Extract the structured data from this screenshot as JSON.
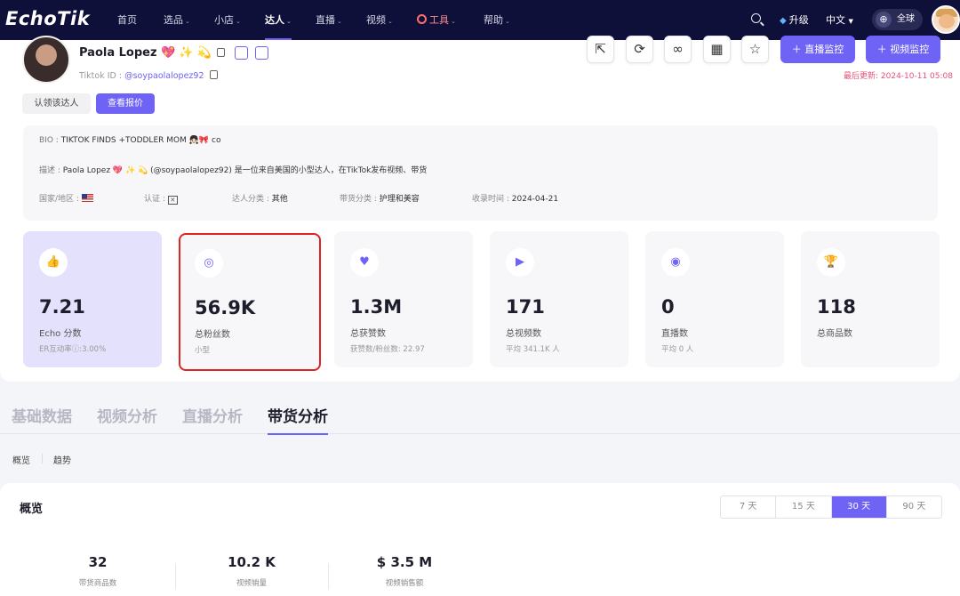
{
  "nav": {
    "logo": "EchoTik",
    "items": [
      {
        "label": "首页",
        "caret": ""
      },
      {
        "label": "选品",
        "caret": "⌄"
      },
      {
        "label": "小店",
        "caret": "⌄"
      },
      {
        "label": "达人",
        "caret": "⌄"
      },
      {
        "label": "直播",
        "caret": "⌄"
      },
      {
        "label": "视频",
        "caret": "⌄"
      },
      {
        "label": "工具",
        "caret": "⌄"
      },
      {
        "label": "帮助",
        "caret": "⌄"
      }
    ],
    "active_index": 3,
    "upgrade": "升级",
    "language": "中文",
    "region": "全球"
  },
  "profile": {
    "name": "Paola Lopez",
    "name_emoji": "💖 ✨ 💫",
    "handle_prefix": "Tiktok ID :",
    "handle": "@soypaolalopez92",
    "updated": "最后更新: 2024-10-11 05:08",
    "claim_button": "认领该达人",
    "quote_button": "查看报价",
    "live_monitor": "直播监控",
    "video_monitor": "视频监控",
    "bio_label": "BIO :",
    "bio": "TIKTOK FINDS +TODDLER MOM 👧🏻🎀 co",
    "desc_label": "描述 :",
    "desc": "Paola Lopez 💖 ✨ 💫 (@soypaolalopez92) 是一位来自美国的小型达人，在TikTok发布视频、带货",
    "country_label": "国家/地区 :",
    "verify_label": "认证 :",
    "category_label": "达人分类 :",
    "category": "其他",
    "goods_category_label": "带货分类 :",
    "goods_category": "护理和美容",
    "indexed_label": "收录时间 :",
    "indexed": "2024-04-21"
  },
  "stats": [
    {
      "icon": "thumbs-up-icon",
      "glyph": "👍",
      "value": "7.21",
      "label": "Echo 分数",
      "sub": "ER互动率ⓘ:3.00%"
    },
    {
      "icon": "target-icon",
      "glyph": "◎",
      "value": "56.9K",
      "label": "总粉丝数",
      "sub": "小型"
    },
    {
      "icon": "heart-icon",
      "glyph": "♥",
      "value": "1.3M",
      "label": "总获赞数",
      "sub": "获赞数/粉丝数: 22.97"
    },
    {
      "icon": "video-icon",
      "glyph": "▶",
      "value": "171",
      "label": "总视频数",
      "sub": "平均 341.1K 人"
    },
    {
      "icon": "live-icon",
      "glyph": "◉",
      "value": "0",
      "label": "直播数",
      "sub": "平均 0 人"
    },
    {
      "icon": "trophy-icon",
      "glyph": "🏆",
      "value": "118",
      "label": "总商品数",
      "sub": ""
    }
  ],
  "tabs": [
    "基础数据",
    "视频分析",
    "直播分析",
    "带货分析"
  ],
  "active_tab": 3,
  "subtabs": [
    "概览",
    "趋势"
  ],
  "overview": {
    "title": "概览",
    "ranges": [
      "7 天",
      "15 天",
      "30 天",
      "90 天"
    ],
    "active_range": 2,
    "stats": [
      {
        "value": "32",
        "label": "带货商品数"
      },
      {
        "value": "10.2 K",
        "label": "视频销量"
      },
      {
        "value": "$ 3.5 M",
        "label": "视频销售额"
      }
    ]
  },
  "colors": {
    "accent": "#6f63f5",
    "nav_bg": "#0f1039",
    "highlight_border": "#e02424",
    "updated_text": "#e5537a"
  }
}
